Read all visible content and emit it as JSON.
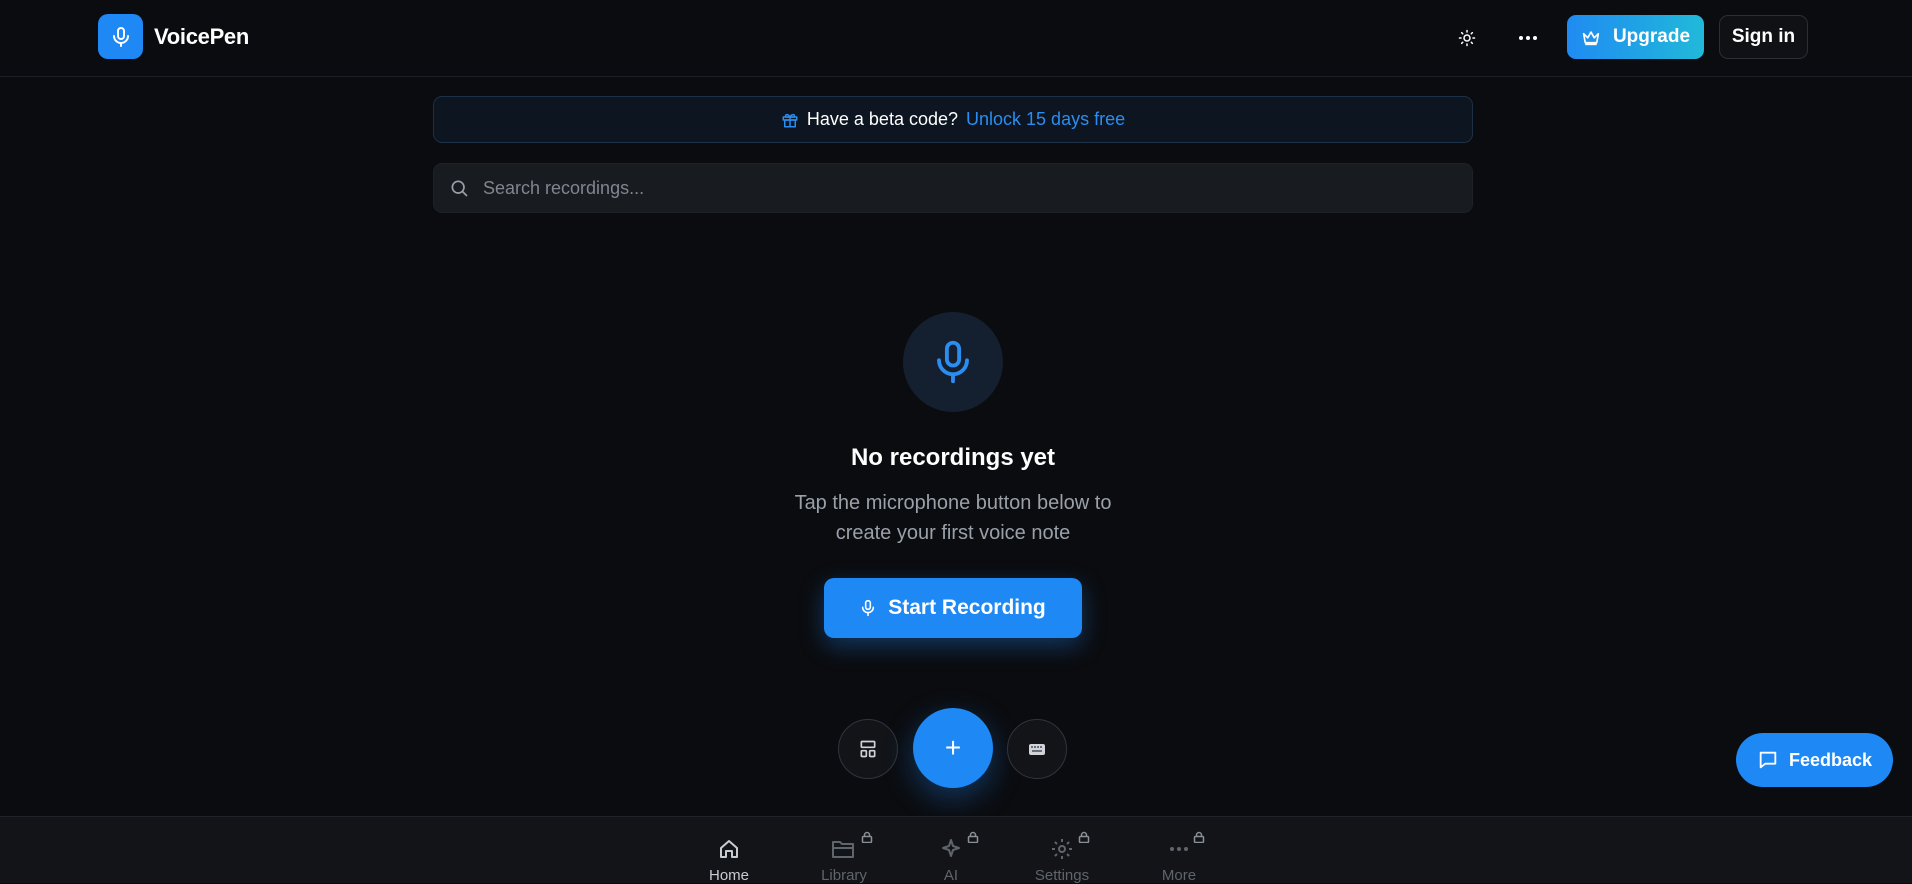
{
  "app": {
    "name": "VoicePen"
  },
  "header": {
    "theme_icon": "sun-icon",
    "more_icon": "ellipsis-icon",
    "upgrade_label": "Upgrade",
    "signin_label": "Sign in"
  },
  "banner": {
    "prefix": "Have a beta code?",
    "link": "Unlock 15 days free"
  },
  "search": {
    "placeholder": "Search recordings..."
  },
  "empty_state": {
    "title": "No recordings yet",
    "line1": "Tap the microphone button below to",
    "line2": "create your first voice note"
  },
  "actions": {
    "start_label": "Start Recording",
    "fab_symbol": "+"
  },
  "feedback": {
    "label": "Feedback"
  },
  "nav": {
    "items": [
      {
        "label": "Home",
        "icon": "home-icon",
        "locked": false,
        "active": true
      },
      {
        "label": "Library",
        "icon": "folder-icon",
        "locked": true,
        "active": false
      },
      {
        "label": "AI",
        "icon": "sparkles-icon",
        "locked": true,
        "active": false
      },
      {
        "label": "Settings",
        "icon": "gear-icon",
        "locked": true,
        "active": false
      },
      {
        "label": "More",
        "icon": "ellipsis-icon",
        "locked": true,
        "active": false
      }
    ]
  },
  "colors": {
    "accent": "#1e88f5",
    "background": "#0b0c0f",
    "link": "#2b8df0"
  }
}
